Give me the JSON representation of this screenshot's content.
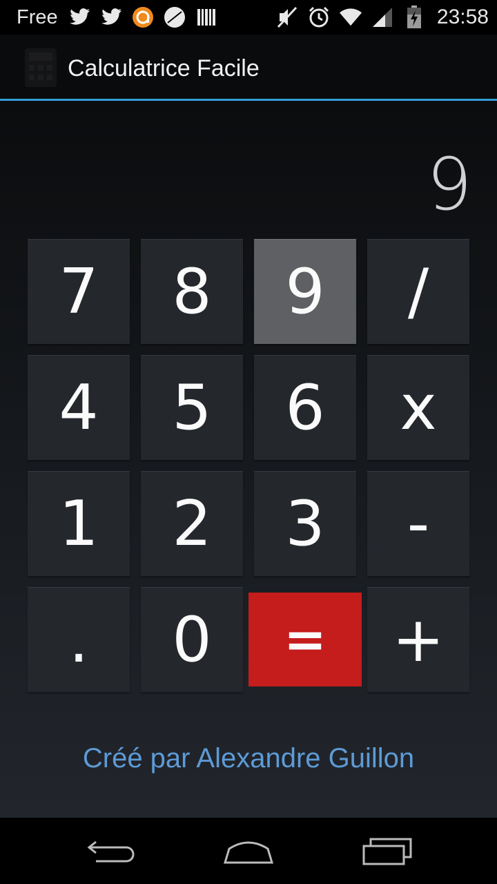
{
  "status_bar": {
    "carrier": "Free",
    "time": "23:58",
    "left_icons": [
      "twitter-icon",
      "twitter-icon",
      "app-notification-icon",
      "sport-icon",
      "barcode-icon"
    ],
    "right_icons": [
      "mute-icon",
      "alarm-icon",
      "wifi-icon",
      "signal-icon",
      "battery-charging-icon"
    ]
  },
  "action_bar": {
    "title": "Calculatrice Facile"
  },
  "display": {
    "value": "9"
  },
  "keypad": {
    "k7": "7",
    "k8": "8",
    "k9": "9",
    "div": "/",
    "k4": "4",
    "k5": "5",
    "k6": "6",
    "mul": "x",
    "k1": "1",
    "k2": "2",
    "k3": "3",
    "sub": "-",
    "dot": ".",
    "k0": "0",
    "eq": "=",
    "add": "+"
  },
  "credit": "Créé par Alexandre Guillon",
  "colors": {
    "accent_divider": "#33a0d8",
    "equals_key": "#c51c1c",
    "key_bg": "#24282d",
    "pressed_key": "#5f6063",
    "credit_text": "#5d9bd6"
  },
  "nav_bar": {
    "buttons": [
      "back-icon",
      "home-icon",
      "recent-apps-icon"
    ]
  }
}
